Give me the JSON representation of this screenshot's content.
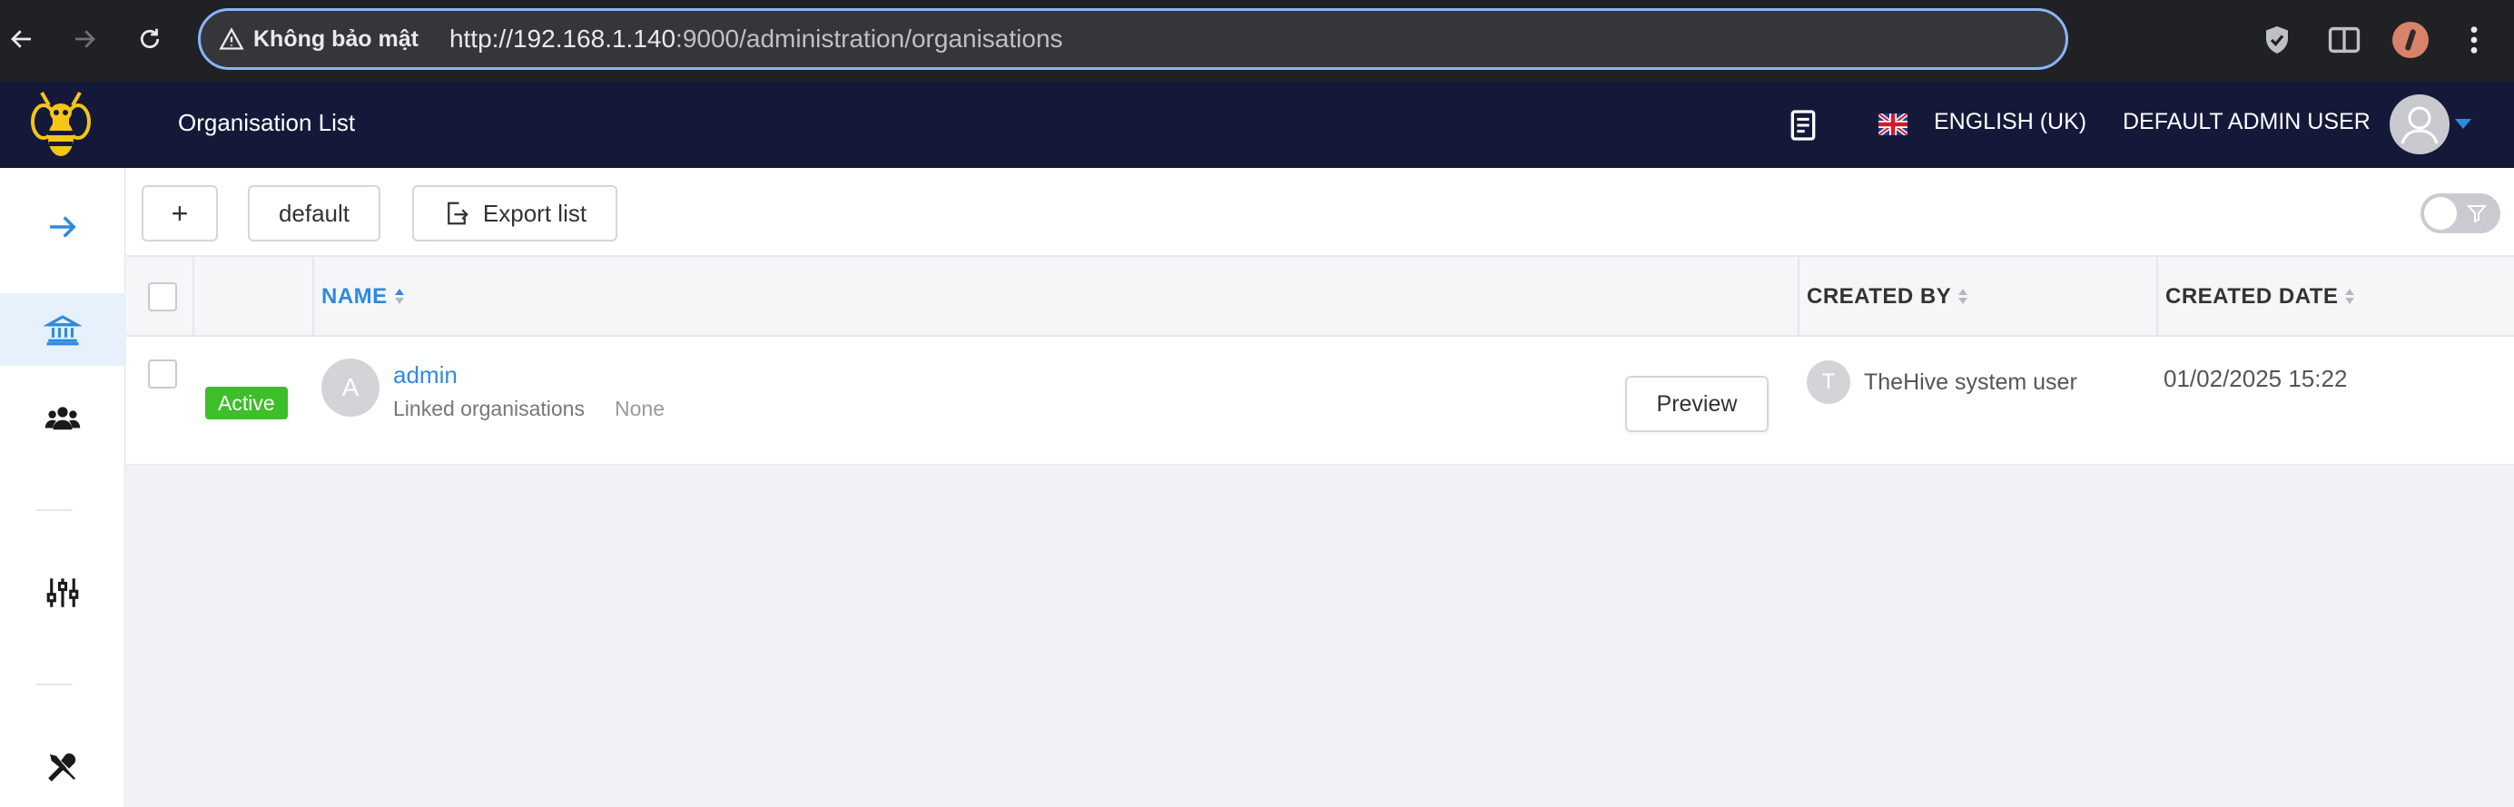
{
  "browser": {
    "security_warning": "Không bảo mật",
    "url_host": "http://192.168.1.140",
    "url_rest": ":9000/administration/organisations"
  },
  "header": {
    "page_title": "Organisation List",
    "language": "ENGLISH (UK)",
    "user_name": "DEFAULT ADMIN USER"
  },
  "toolbar": {
    "add_label": "+",
    "default_label": "default",
    "export_label": "Export list"
  },
  "table": {
    "columns": [
      {
        "label": "NAME",
        "sorted": "asc"
      },
      {
        "label": "CREATED BY",
        "sorted": "none"
      },
      {
        "label": "CREATED DATE",
        "sorted": "none"
      }
    ],
    "rows": [
      {
        "status": "Active",
        "avatar_letter": "A",
        "name": "admin",
        "linked_label": "Linked organisations",
        "linked_value": "None",
        "preview_label": "Preview",
        "created_by_initial": "T",
        "created_by": "TheHive system user",
        "created_date": "01/02/2025 15:22"
      }
    ]
  },
  "colors": {
    "accent": "#2f8ae0",
    "header_bg": "#151939",
    "status_active": "#3cbf28",
    "browser_bg": "#202124"
  },
  "icons": {
    "sidebar": [
      "arrow-right-icon",
      "bank-icon",
      "users-icon",
      "sliders-icon",
      "tools-icon"
    ]
  }
}
